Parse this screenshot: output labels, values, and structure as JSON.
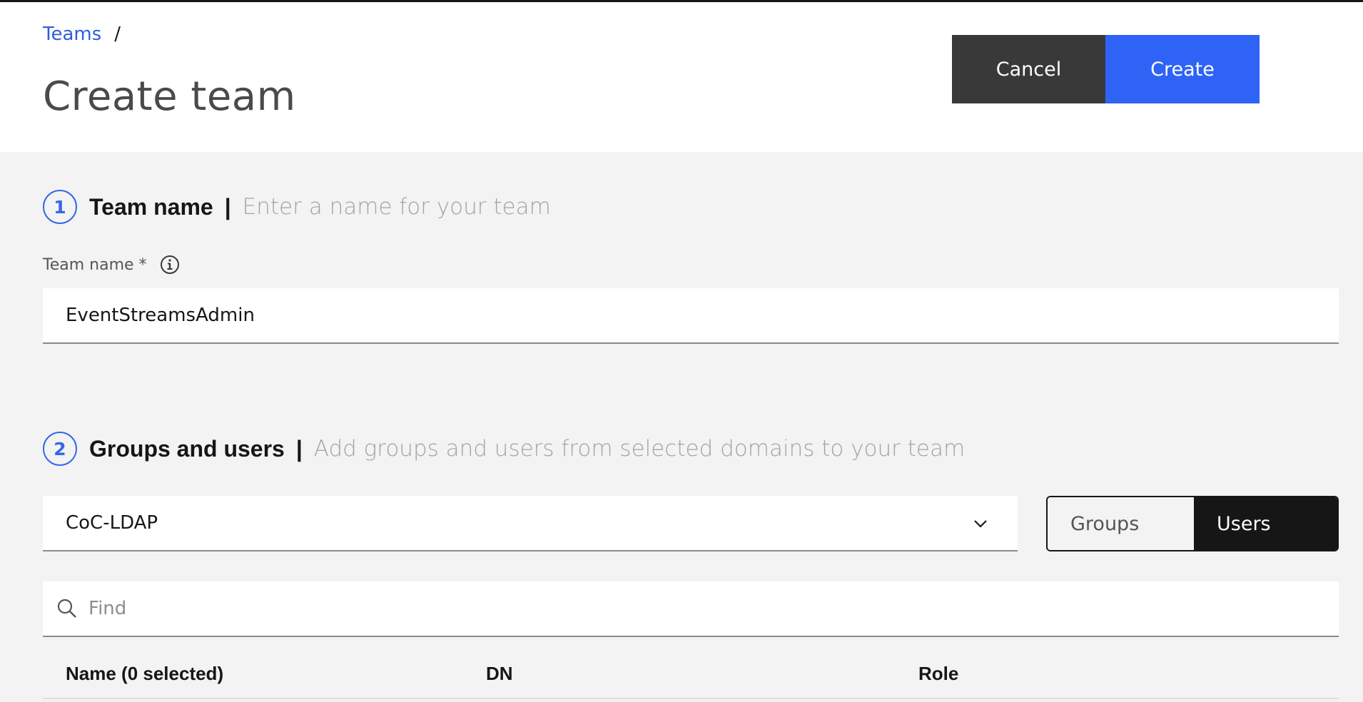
{
  "breadcrumb": {
    "link": "Teams",
    "separator": "/"
  },
  "page_title": "Create team",
  "actions": {
    "cancel": "Cancel",
    "create": "Create"
  },
  "section1": {
    "number": "1",
    "title": "Team name",
    "pipe": "|",
    "subtitle": "Enter a name for your team",
    "field_label": "Team name *",
    "field_value": "EventStreamsAdmin",
    "info_icon": "information-icon"
  },
  "section2": {
    "number": "2",
    "title": "Groups and users",
    "pipe": "|",
    "subtitle": "Add groups and users from selected domains to your team",
    "domain_selected": "CoC-LDAP",
    "toggle": {
      "groups": "Groups",
      "users": "Users",
      "active": "Users"
    },
    "search_placeholder": "Find",
    "table": {
      "columns": [
        "Name (0 selected)",
        "DN",
        "Role"
      ]
    }
  },
  "colors": {
    "link": "#2f5fd8",
    "primary_button": "#2e63f6",
    "secondary_button": "#393939",
    "step_accent": "#3766e8",
    "page_background": "#f3f3f3"
  }
}
